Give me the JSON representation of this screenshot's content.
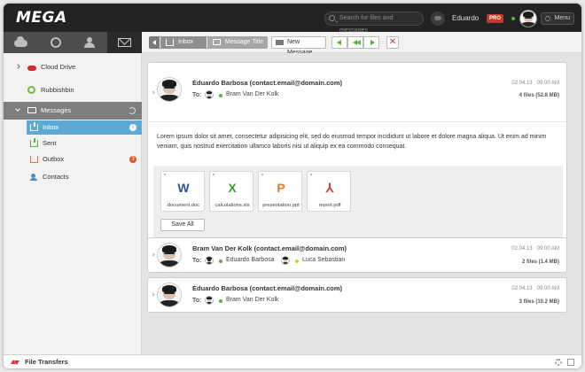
{
  "app": {
    "logo": "MEGA"
  },
  "topbar": {
    "search_placeholder": "Search for files and messages",
    "user_name": "Eduardo",
    "plan_badge": "PRO",
    "menu_label": "Menu"
  },
  "sidebar": {
    "tabs": [
      "cloud-drive-icon",
      "rubbish-bin-icon",
      "contacts-icon",
      "messages-icon"
    ],
    "items": {
      "cloud_drive": "Cloud Drive",
      "rubbish_bin": "Rubbishbin",
      "messages": "Messages",
      "inbox": "Inbox",
      "inbox_badge": "i",
      "sent": "Sent",
      "outbox": "Outbox",
      "outbox_count": "3",
      "contacts": "Contacts"
    }
  },
  "toolbar": {
    "breadcrumb": {
      "folder": "Inbox",
      "current": "Message Title"
    },
    "new_message_label": "New Message",
    "delete_glyph": "✕"
  },
  "messages": [
    {
      "sender": "Eduardo Barbosa (contact.email@domain.com)",
      "to_label": "To:",
      "recipients": [
        "Bram Van Der Kolk"
      ],
      "date": "02.04.13",
      "time": "09:00 AM",
      "files": "4 files (52.8 MB)",
      "body": "Lorem ipsum dolor sit amet, consectetur adipisicing elit, sed do eiusmod tempor incididunt ut labore et dolore magna aliqua. Ut enim ad minim veniam, quis nostrud exercitation ullamco laboris nisi ut aliquip ex ea commodo consequat.",
      "attachments": [
        {
          "name": "document.doc",
          "glyph": "W",
          "color": "#2b5797"
        },
        {
          "name": "calculations.xls",
          "glyph": "X",
          "color": "#3a9b3a"
        },
        {
          "name": "presentation.ppt",
          "glyph": "P",
          "color": "#e07a2c"
        },
        {
          "name": "report.pdf",
          "glyph": "⅄",
          "color": "#d33a2c"
        }
      ],
      "save_all_label": "Save All"
    },
    {
      "sender": "Bram Van Der Kolk (contact.email@domain.com)",
      "to_label": "To:",
      "recipients": [
        "Eduardo Barbosa",
        "Luca Sebastian"
      ],
      "date": "02.04.13",
      "time": "09:00 AM",
      "files": "2 files (1.4 MB)"
    },
    {
      "sender": "Eduardo Barbosa (contact.email@domain.com)",
      "to_label": "To:",
      "recipients": [
        "Bram Van Der Kolk"
      ],
      "date": "02.04.13",
      "time": "09:00 AM",
      "files": "3 files (10.2 MB)"
    }
  ],
  "footer": {
    "label": "File Transfers"
  },
  "colors": {
    "accent_blue": "#5ca9d6",
    "online_green": "#5bb03a",
    "away_yellow": "#f0c419",
    "pro_red": "#c0392b"
  }
}
